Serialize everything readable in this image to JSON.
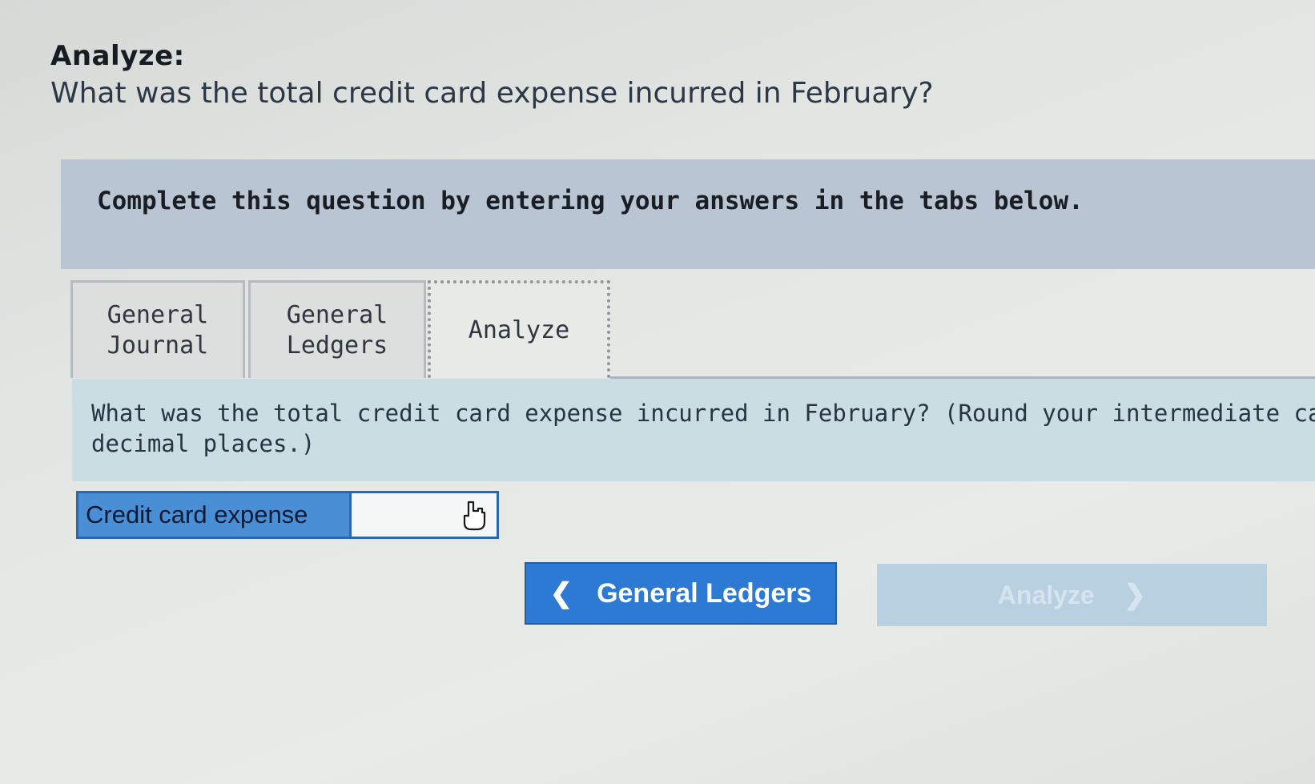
{
  "header": {
    "title": "Analyze:",
    "question": "What was the total credit card expense incurred in February?"
  },
  "instructions": {
    "text": "Complete this question by entering your answers in the tabs below."
  },
  "tabs": [
    {
      "label": "General\nJournal",
      "active": false
    },
    {
      "label": "General\nLedgers",
      "active": false
    },
    {
      "label": "Analyze",
      "active": true
    }
  ],
  "analyze_panel": {
    "question": "What was the total credit card expense incurred in February? (Round your intermediate calculatior",
    "question_line2": "decimal places.)"
  },
  "answer": {
    "label": "Credit card expense",
    "value": ""
  },
  "navigation": {
    "back_label": "General Ledgers",
    "back_icon": "chevron-left-icon",
    "next_label": "Analyze",
    "next_icon": "chevron-right-icon",
    "next_disabled": true
  },
  "colors": {
    "primary_button": "#2c7ad3",
    "label_cell": "#4a8fd6",
    "instruction_bg": "#b9c5d2",
    "question_bg": "#c9dde3"
  }
}
